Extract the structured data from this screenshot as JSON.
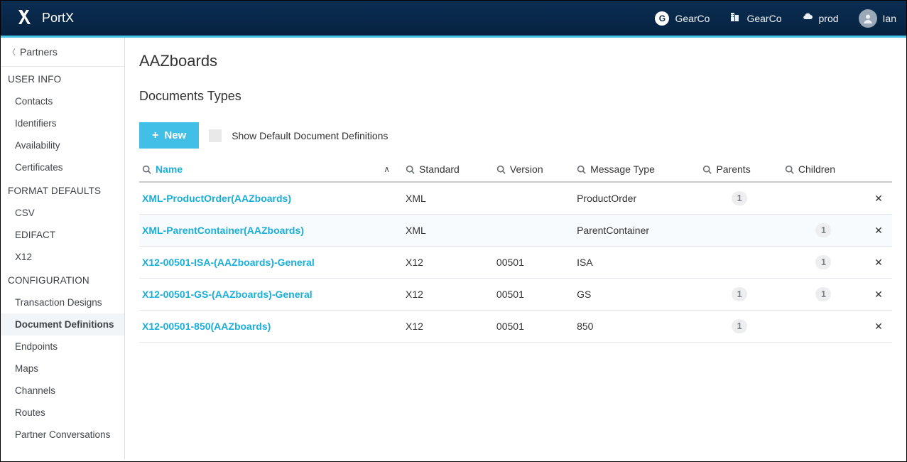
{
  "header": {
    "app_name": "PortX",
    "org_badge_letter": "G",
    "org_name1": "GearCo",
    "org_name2": "GearCo",
    "env_label": "prod",
    "user_name": "Ian"
  },
  "sidebar": {
    "back_label": "Partners",
    "sections": [
      {
        "title": "USER INFO",
        "items": [
          "Contacts",
          "Identifiers",
          "Availability",
          "Certificates"
        ]
      },
      {
        "title": "FORMAT DEFAULTS",
        "items": [
          "CSV",
          "EDIFACT",
          "X12"
        ]
      },
      {
        "title": "CONFIGURATION",
        "items": [
          "Transaction Designs",
          "Document Definitions",
          "Endpoints",
          "Maps",
          "Channels",
          "Routes",
          "Partner Conversations"
        ]
      }
    ],
    "active_item": "Document Definitions"
  },
  "main": {
    "page_title": "AAZboards",
    "section_title": "Documents Types",
    "new_button_label": "New",
    "show_defaults_label": "Show Default Document Definitions"
  },
  "table": {
    "columns": [
      "Name",
      "Standard",
      "Version",
      "Message Type",
      "Parents",
      "Children"
    ],
    "sorted_column": "Name",
    "rows": [
      {
        "name": "XML-ProductOrder(AAZboards)",
        "standard": "XML",
        "version": "",
        "message_type": "ProductOrder",
        "parents": "1",
        "children": "",
        "highlight": false
      },
      {
        "name": "XML-ParentContainer(AAZboards)",
        "standard": "XML",
        "version": "",
        "message_type": "ParentContainer",
        "parents": "",
        "children": "1",
        "highlight": true
      },
      {
        "name": "X12-00501-ISA-(AAZboards)-General",
        "standard": "X12",
        "version": "00501",
        "message_type": "ISA",
        "parents": "",
        "children": "1",
        "highlight": false
      },
      {
        "name": "X12-00501-GS-(AAZboards)-General",
        "standard": "X12",
        "version": "00501",
        "message_type": "GS",
        "parents": "1",
        "children": "1",
        "highlight": false
      },
      {
        "name": "X12-00501-850(AAZboards)",
        "standard": "X12",
        "version": "00501",
        "message_type": "850",
        "parents": "1",
        "children": "",
        "highlight": false
      }
    ]
  }
}
